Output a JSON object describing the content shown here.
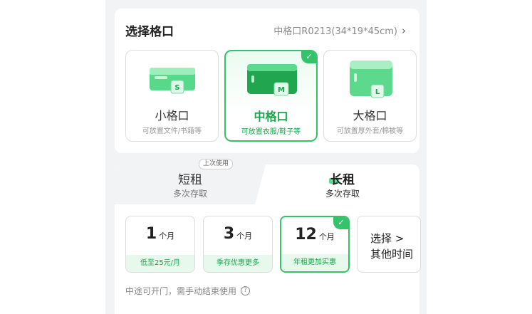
{
  "section": {
    "title": "选择格口",
    "spec": "中格口R0213(34*19*45cm)"
  },
  "sizes": [
    {
      "name": "小格口",
      "desc": "可放置文件/书籍等",
      "badge": "S",
      "selected": false
    },
    {
      "name": "中格口",
      "desc": "可放置衣服/鞋子等",
      "badge": "M",
      "selected": true
    },
    {
      "name": "大格口",
      "desc": "可放置厚外套/棉被等",
      "badge": "L",
      "selected": false
    }
  ],
  "rent_tabs": {
    "short": {
      "title": "短租",
      "sub": "多次存取",
      "tag": "上次使用"
    },
    "long": {
      "title": "长租",
      "sub": "多次存取"
    }
  },
  "durations": [
    {
      "num": "1",
      "unit": "个月",
      "foot": "低至25元/月",
      "selected": false
    },
    {
      "num": "3",
      "unit": "个月",
      "foot": "季存优惠更多",
      "selected": false
    },
    {
      "num": "12",
      "unit": "个月",
      "foot": "年租更加实惠",
      "selected": true
    }
  ],
  "other_time": {
    "line1": "选择 >",
    "line2": "其他时间"
  },
  "note": "中途可开门，需手动结束使用",
  "colors": {
    "accent": "#34c26a",
    "accent_text": "#19a74c",
    "bg": "#f2f3f5"
  }
}
